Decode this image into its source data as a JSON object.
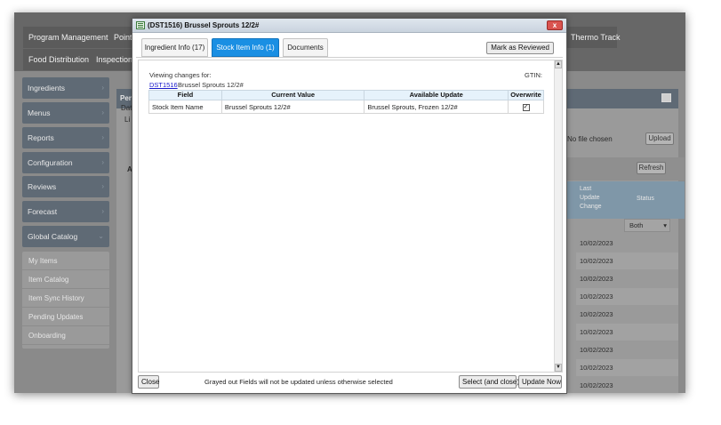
{
  "background": {
    "top_nav": [
      "Program Management",
      "Point o",
      "Thermo Track"
    ],
    "top_nav_row2": [
      "Food Distribution",
      "Inspections"
    ],
    "sidebar": [
      {
        "label": "Ingredients"
      },
      {
        "label": "Menus"
      },
      {
        "label": "Reports"
      },
      {
        "label": "Configuration"
      },
      {
        "label": "Reviews"
      },
      {
        "label": "Forecast"
      },
      {
        "label": "Global Catalog"
      }
    ],
    "sidebar_sub": [
      "My Items",
      "Item Catalog",
      "Item Sync History",
      "Pending Updates",
      "Onboarding"
    ],
    "panel_title": "Pend",
    "panel_text_1": "Dat",
    "panel_text_2": "Li",
    "panel_text_3": "A",
    "no_file_chosen": "No file chosen",
    "upload_label": "Upload",
    "refresh_label": "Refresh",
    "grid_headers": {
      "last_update_change": "Last Update Change",
      "status": "Status"
    },
    "status_filter": "Both",
    "row_dates": [
      "10/02/2023",
      "10/02/2023",
      "10/02/2023",
      "10/02/2023",
      "10/02/2023",
      "10/02/2023",
      "10/02/2023",
      "10/02/2023",
      "10/02/2023"
    ]
  },
  "dialog": {
    "title": "(DST1516) Brussel Sprouts 12/2#",
    "close_symbol": "x",
    "tabs": [
      {
        "label": "Ingredient Info (17)",
        "active": false
      },
      {
        "label": "Stock Item Info (1)",
        "active": true
      },
      {
        "label": "Documents",
        "active": false
      }
    ],
    "mark_reviewed_label": "Mark as Reviewed",
    "viewing_label": "Viewing changes for:",
    "gtin_label": "GTIN:",
    "item_code": "DST1516",
    "item_name": "Brussel Sprouts 12/2#",
    "table": {
      "headers": [
        "Field",
        "Current Value",
        "Available Update",
        "Overwrite"
      ],
      "rows": [
        {
          "field": "Stock Item Name",
          "current": "Brussel Sprouts 12/2#",
          "update": "Brussel Sprouts, Frozen 12/2#",
          "overwrite": true
        }
      ]
    },
    "footer": {
      "close_label": "Close",
      "note": "Grayed out Fields will not be updated unless otherwise selected",
      "select_close_label": "Select (and close)",
      "update_now_label": "Update Now"
    },
    "accent_color": "#1a8fe3"
  }
}
